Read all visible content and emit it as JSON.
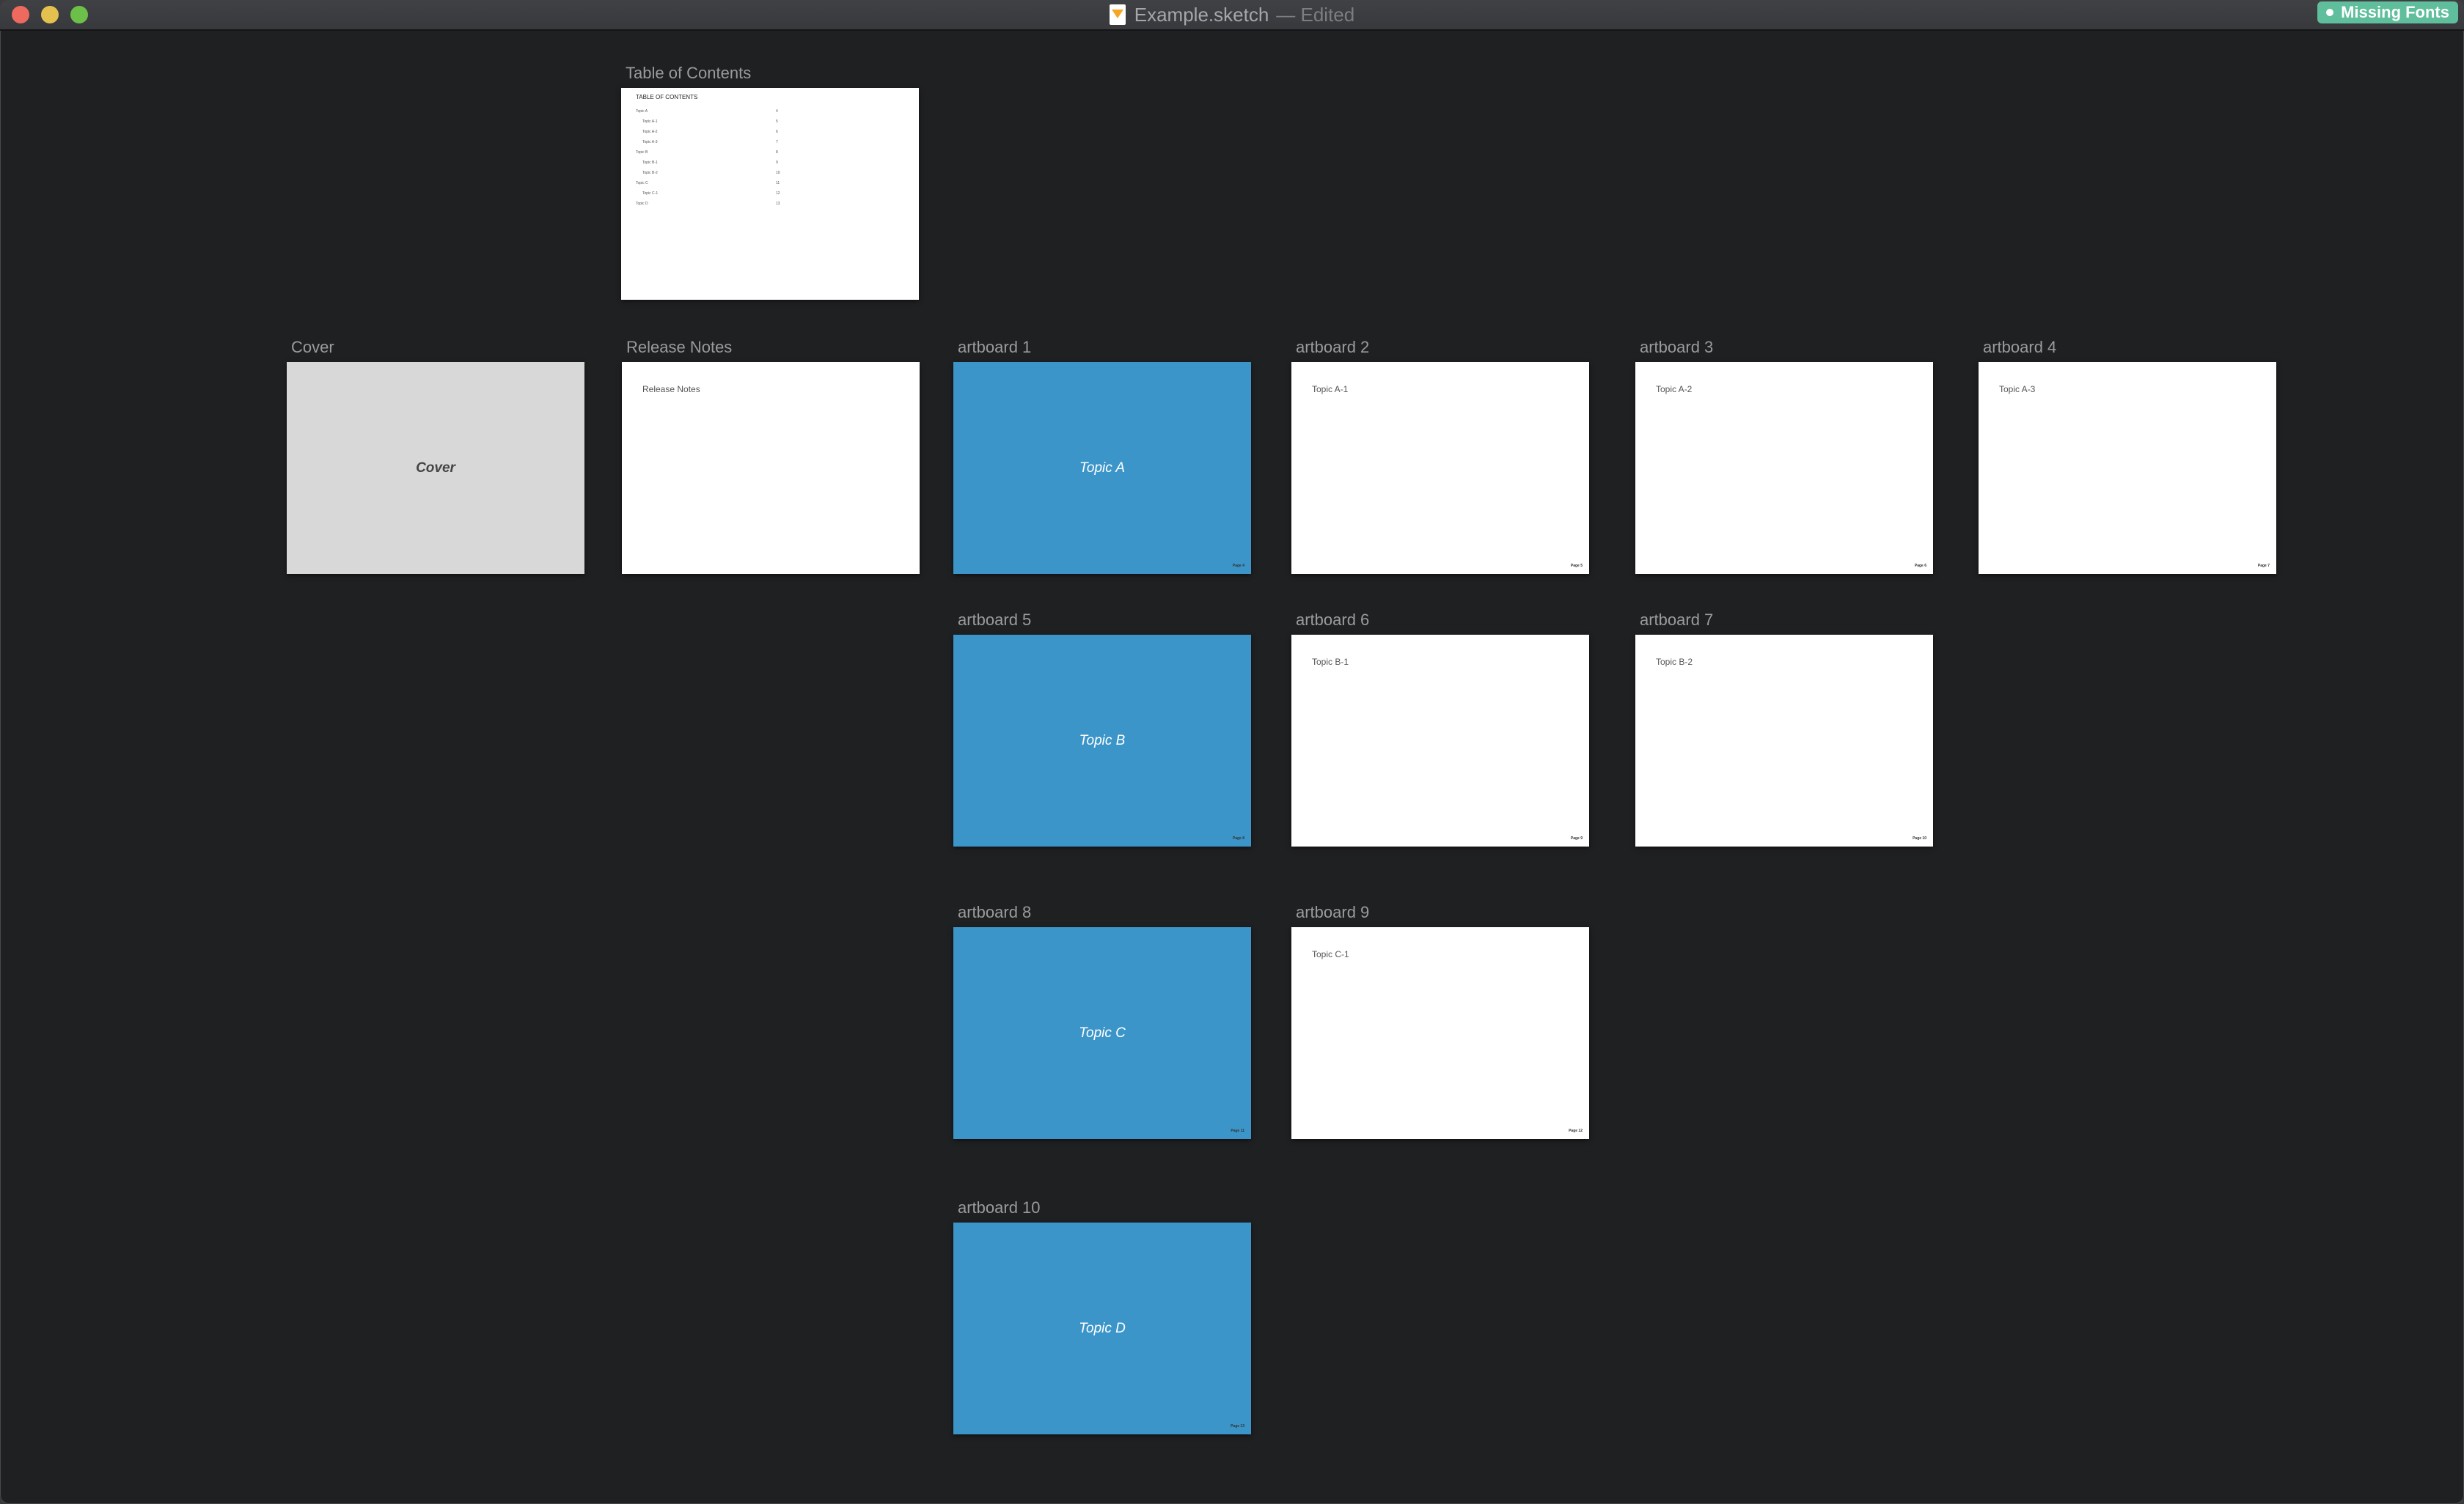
{
  "window": {
    "title": "Example.sketch",
    "status": "— Edited",
    "badge": "Missing Fonts",
    "colors": {
      "badge": "#5fbe9b",
      "close": "#ee6a5f",
      "minimize": "#e4c14f",
      "maximize": "#6cc04a",
      "canvas": "#1f2022",
      "topic_blue": "#3c95c9"
    }
  },
  "toc": {
    "label": "Table of Contents",
    "heading": "TABLE OF CONTENTS",
    "entries": [
      {
        "title": "Topic A",
        "page": "4"
      },
      {
        "title": "Topic A-1",
        "page": "5"
      },
      {
        "title": "Topic A-2",
        "page": "6"
      },
      {
        "title": "Topic A-3",
        "page": "7"
      },
      {
        "title": "Topic B",
        "page": "8"
      },
      {
        "title": "Topic B-1",
        "page": "9"
      },
      {
        "title": "Topic B-2",
        "page": "10"
      },
      {
        "title": "Topic C",
        "page": "11"
      },
      {
        "title": "Topic C-1",
        "page": "12"
      },
      {
        "title": "Topic D",
        "page": "13"
      }
    ]
  },
  "cover": {
    "label": "Cover",
    "title": "Cover"
  },
  "release_notes": {
    "label": "Release Notes",
    "heading": "Release Notes"
  },
  "artboards": [
    {
      "label": "artboard 1",
      "title": "Topic A",
      "footer": "Page 4"
    },
    {
      "label": "artboard 2",
      "title": "Topic A-1",
      "footer": "Page 5"
    },
    {
      "label": "artboard 3",
      "title": "Topic A-2",
      "footer": "Page 6"
    },
    {
      "label": "artboard 4",
      "title": "Topic A-3",
      "footer": "Page 7"
    },
    {
      "label": "artboard 5",
      "title": "Topic B",
      "footer": "Page 8"
    },
    {
      "label": "artboard 6",
      "title": "Topic B-1",
      "footer": "Page 9"
    },
    {
      "label": "artboard 7",
      "title": "Topic B-2",
      "footer": "Page 10"
    },
    {
      "label": "artboard 8",
      "title": "Topic C",
      "footer": "Page 11"
    },
    {
      "label": "artboard 9",
      "title": "Topic C-1",
      "footer": "Page 12"
    },
    {
      "label": "artboard 10",
      "title": "Topic D",
      "footer": "Page 13"
    }
  ]
}
